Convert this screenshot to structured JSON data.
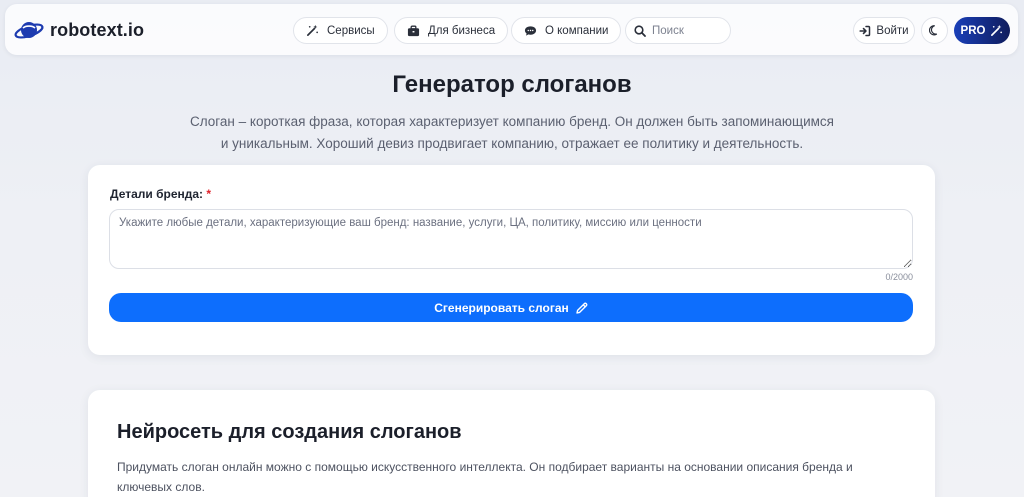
{
  "header": {
    "logo_text": "robotext.io",
    "nav": [
      {
        "label": "Сервисы",
        "icon": "magic-wand-icon"
      },
      {
        "label": "Для бизнеса",
        "icon": "briefcase-icon"
      },
      {
        "label": "О компании",
        "icon": "chat-bubble-icon"
      }
    ],
    "search_placeholder": "Поиск",
    "login_label": "Войти",
    "pro_label": "PRO"
  },
  "hero": {
    "title": "Генератор слоганов",
    "description": "Слоган – короткая фраза, которая характеризует компанию бренд. Он должен быть запоминающимся и уникальным. Хороший девиз продвигает компанию, отражает ее политику и деятельность."
  },
  "form": {
    "label": "Детали бренда:",
    "required_mark": "*",
    "placeholder": "Укажите любые детали, характеризующие ваш бренд: название, услуги, ЦА, политику, миссию или ценности",
    "value": "",
    "counter": "0/2000",
    "button_label": "Сгенерировать слоган"
  },
  "info": {
    "title": "Нейросеть для создания слоганов",
    "text": "Придумать слоган онлайн можно с помощью искусственного интеллекта. Он подбирает варианты на основании описания бренда и ключевых слов."
  },
  "colors": {
    "accent": "#0d6efd",
    "pro_gradient_start": "#1a3fb8",
    "pro_gradient_end": "#0f1c5c",
    "required": "#e0232b"
  }
}
